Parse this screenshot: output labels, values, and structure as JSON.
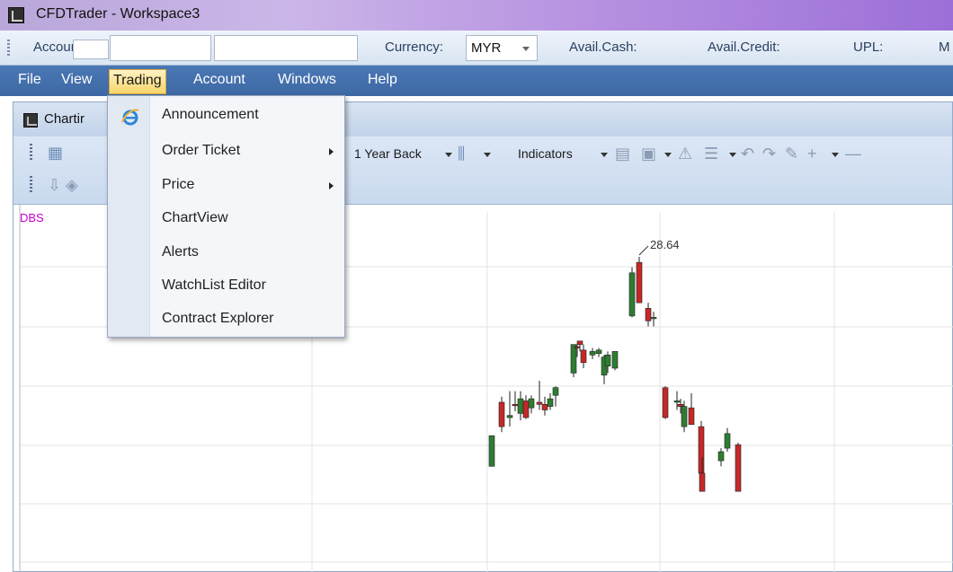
{
  "window": {
    "title": "CFDTrader - Workspace3"
  },
  "account_bar": {
    "account_label": "Account:",
    "account_value_1": "",
    "account_value_2": "",
    "currency_label": "Currency:",
    "currency_value": "MYR",
    "avail_cash_label": "Avail.Cash:",
    "avail_credit_label": "Avail.Credit:",
    "upl_label": "UPL:",
    "truncated_label": "M"
  },
  "menubar": {
    "items": [
      {
        "label": "File"
      },
      {
        "label": "View"
      },
      {
        "label": "Trading"
      },
      {
        "label": "Account"
      },
      {
        "label": "Windows"
      },
      {
        "label": "Help"
      }
    ],
    "active": "Trading"
  },
  "trading_menu": {
    "items": [
      {
        "label": "Announcement",
        "icon": "ie-icon"
      },
      {
        "label": "Order Ticket",
        "submenu": true
      },
      {
        "label": "Price",
        "submenu": true
      },
      {
        "label": "ChartView"
      },
      {
        "label": "Alerts"
      },
      {
        "label": "WatchList Editor"
      },
      {
        "label": "Contract Explorer"
      }
    ]
  },
  "chart_window": {
    "caption": "Chartir",
    "toolbar": {
      "period": "1 Year Back",
      "indicators": "Indicators"
    },
    "symbol": "DBS",
    "annotation": "28.64"
  },
  "chart_data": {
    "type": "candlestick",
    "symbol": "DBS",
    "annotation": "28.64",
    "colors": {
      "up": "#2e7d32",
      "down": "#c62828"
    },
    "candles": [
      {
        "o": 25.63,
        "h": 26.07,
        "l": 25.63,
        "c": 26.07
      },
      {
        "o": 26.55,
        "h": 26.63,
        "l": 26.12,
        "c": 26.2
      },
      {
        "o": 26.33,
        "h": 26.71,
        "l": 26.2,
        "c": 26.36
      },
      {
        "o": 26.52,
        "h": 26.71,
        "l": 26.42,
        "c": 26.5
      },
      {
        "o": 26.39,
        "h": 26.71,
        "l": 26.29,
        "c": 26.6
      },
      {
        "o": 26.57,
        "h": 26.65,
        "l": 26.31,
        "c": 26.33
      },
      {
        "o": 26.47,
        "h": 26.65,
        "l": 26.39,
        "c": 26.6
      },
      {
        "o": 26.55,
        "h": 26.86,
        "l": 26.44,
        "c": 26.52
      },
      {
        "o": 26.52,
        "h": 26.63,
        "l": 26.36,
        "c": 26.44
      },
      {
        "o": 26.49,
        "h": 26.68,
        "l": 26.44,
        "c": 26.6
      },
      {
        "o": 26.65,
        "h": 26.78,
        "l": 26.49,
        "c": 26.76
      },
      {
        "o": 26.97,
        "h": 27.38,
        "l": 26.91,
        "c": 27.38
      },
      {
        "o": 27.35,
        "h": 27.38,
        "l": 27.2,
        "c": 27.33
      },
      {
        "o": 27.43,
        "h": 27.43,
        "l": 27.28,
        "c": 27.38
      },
      {
        "o": 27.3,
        "h": 27.38,
        "l": 27.04,
        "c": 27.12
      },
      {
        "o": 27.23,
        "h": 27.33,
        "l": 27.17,
        "c": 27.28
      },
      {
        "o": 27.25,
        "h": 27.33,
        "l": 27.2,
        "c": 27.3
      },
      {
        "o": 26.94,
        "h": 27.23,
        "l": 26.81,
        "c": 27.2
      },
      {
        "o": 27.07,
        "h": 27.28,
        "l": 26.97,
        "c": 27.23
      },
      {
        "o": 27.04,
        "h": 27.28,
        "l": 27.01,
        "c": 27.28
      },
      {
        "o": 27.79,
        "h": 28.49,
        "l": 27.77,
        "c": 28.41
      },
      {
        "o": 28.56,
        "h": 28.64,
        "l": 27.98,
        "c": 27.98
      },
      {
        "o": 27.9,
        "h": 27.98,
        "l": 27.64,
        "c": 27.72
      },
      {
        "o": 27.77,
        "h": 27.85,
        "l": 27.64,
        "c": 27.77
      },
      {
        "o": 26.76,
        "h": 26.78,
        "l": 26.31,
        "c": 26.33
      },
      {
        "o": 26.57,
        "h": 26.71,
        "l": 26.44,
        "c": 26.57
      },
      {
        "o": 26.52,
        "h": 26.6,
        "l": 26.39,
        "c": 26.49
      },
      {
        "o": 26.2,
        "h": 26.57,
        "l": 26.12,
        "c": 26.49
      },
      {
        "o": 26.47,
        "h": 26.68,
        "l": 26.39,
        "c": 26.23
      },
      {
        "o": 26.2,
        "h": 26.28,
        "l": 25.47,
        "c": 25.53
      },
      {
        "o": 25.53,
        "h": 25.76,
        "l": 25.27,
        "c": 25.27
      },
      {
        "o": 25.71,
        "h": 25.89,
        "l": 25.63,
        "c": 25.84
      },
      {
        "o": 25.89,
        "h": 26.18,
        "l": 25.84,
        "c": 26.1
      },
      {
        "o": 25.94,
        "h": 25.97,
        "l": 25.27,
        "c": 25.27
      }
    ]
  }
}
